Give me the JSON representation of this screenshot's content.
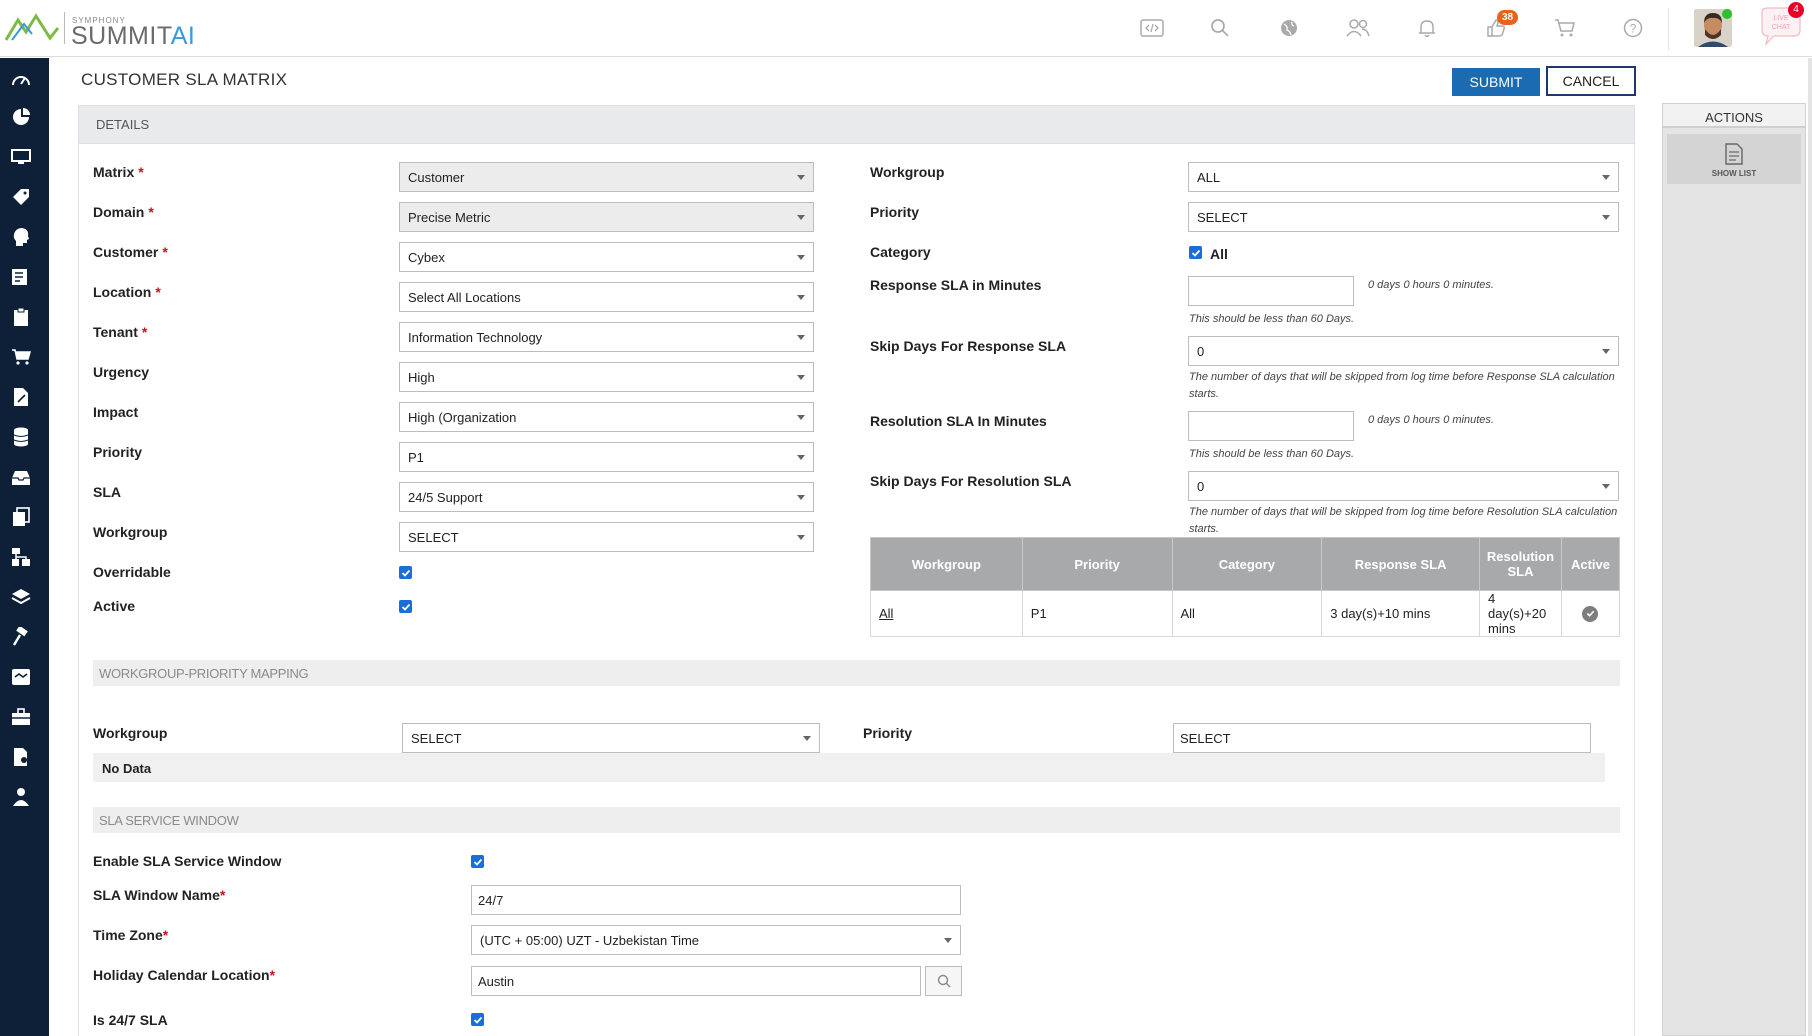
{
  "app": {
    "brand_small": "SYMPHONY",
    "brand_name": "SUMMIT",
    "brand_ai": "AI"
  },
  "topbar": {
    "icons": [
      "code-icon",
      "search-icon",
      "globe-icon",
      "users-icon",
      "bell-icon",
      "thumbs-up-icon",
      "cart-icon",
      "help-icon"
    ],
    "thumbs_badge": "38",
    "chat_label": "LIVE CHAT",
    "chat_badge": "4"
  },
  "sidebar": {
    "icons": [
      "dashboard-icon",
      "pie-chart-icon",
      "monitor-icon",
      "tag-icon",
      "person-head-icon",
      "edit-list-icon",
      "clipboard-icon",
      "cart-icon",
      "document-edit-icon",
      "database-icon",
      "inbox-icon",
      "copy-edit-icon",
      "hierarchy-icon",
      "tray-icon",
      "hammer-icon",
      "handshake-icon",
      "briefcase-icon",
      "document-person-icon",
      "user-tie-icon"
    ]
  },
  "page": {
    "title": "CUSTOMER SLA MATRIX"
  },
  "toolbar": {
    "submit_label": "SUBMIT",
    "cancel_label": "CANCEL"
  },
  "details": {
    "section_label": "DETAILS",
    "left": {
      "matrix": {
        "label": "Matrix",
        "value": "Customer"
      },
      "domain": {
        "label": "Domain",
        "value": "Precise Metric"
      },
      "customer": {
        "label": "Customer",
        "value": "Cybex"
      },
      "location": {
        "label": "Location",
        "value": "Select All Locations"
      },
      "tenant": {
        "label": "Tenant",
        "value": "Information Technology"
      },
      "urgency": {
        "label": "Urgency",
        "value": "High"
      },
      "impact": {
        "label": "Impact",
        "value": "High (Organization"
      },
      "priority": {
        "label": "Priority",
        "value": "P1"
      },
      "sla": {
        "label": "SLA",
        "value": "24/5 Support"
      },
      "workgroup": {
        "label": "Workgroup",
        "value": "SELECT"
      },
      "overridable": {
        "label": "Overridable",
        "checked": true
      },
      "active": {
        "label": "Active",
        "checked": true
      }
    },
    "right": {
      "workgroup": {
        "label": "Workgroup",
        "value": "ALL"
      },
      "priority": {
        "label": "Priority",
        "value": "SELECT"
      },
      "category": {
        "label": "Category",
        "checkbox_label": "All",
        "checked": true
      },
      "response_sla": {
        "label": "Response SLA in Minutes",
        "value": "",
        "duration": "0 days 0 hours 0 minutes.",
        "hint": "This should be less than 60 Days."
      },
      "skip_response": {
        "label": "Skip Days For Response SLA",
        "value": "0",
        "hint_line1": "The number of days that will be skipped from log time before Response SLA calculation",
        "hint_line2": "starts."
      },
      "resolution_sla": {
        "label": "Resolution SLA In Minutes",
        "value": "",
        "duration": "0 days 0 hours 0 minutes.",
        "hint": "This should be less than 60 Days."
      },
      "skip_resolution": {
        "label": "Skip Days For Resolution SLA",
        "value": "0",
        "hint_line1": "The number of days that will be skipped from log time before Resolution SLA calculation",
        "hint_line2": "starts."
      }
    },
    "table": {
      "headers": [
        "Workgroup",
        "Priority",
        "Category",
        "Response SLA",
        "Resolution SLA",
        "Active"
      ],
      "rows": [
        {
          "workgroup": "All",
          "priority": "P1",
          "category": "All",
          "response": "3 day(s)+10 mins",
          "resolution_line1": "4 day(s)+20",
          "resolution_line2": "mins",
          "active": true
        }
      ]
    }
  },
  "mapping": {
    "section_label": "WORKGROUP-PRIORITY MAPPING",
    "workgroup": {
      "label": "Workgroup",
      "value": "SELECT"
    },
    "priority": {
      "label": "Priority",
      "value": "SELECT"
    },
    "no_data": "No Data"
  },
  "service_window": {
    "section_label": "SLA SERVICE WINDOW",
    "enable": {
      "label": "Enable SLA Service Window",
      "checked": true
    },
    "window_name": {
      "label": "SLA Window Name",
      "value": "24/7"
    },
    "time_zone": {
      "label": "Time Zone",
      "value": "(UTC + 05:00) UZT - Uzbekistan Time"
    },
    "holiday": {
      "label": "Holiday Calendar Location",
      "value": "Austin"
    },
    "is_247": {
      "label": "Is 24/7 SLA",
      "checked": true
    }
  },
  "actions": {
    "title": "ACTIONS",
    "show_list_label": "SHOW LIST"
  }
}
